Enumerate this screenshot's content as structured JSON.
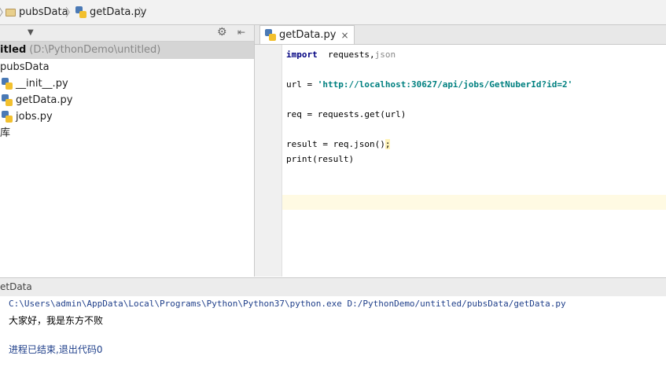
{
  "breadcrumb": {
    "items": [
      {
        "label": "pubsData",
        "icon": "folder-icon"
      },
      {
        "label": "getData.py",
        "icon": "python-file-icon"
      }
    ]
  },
  "project": {
    "root_name": "itled",
    "root_path": "(D:\\PythonDemo\\untitled)",
    "folder": "pubsData",
    "files": [
      "__init__.py",
      "getData.py",
      "jobs.py"
    ],
    "extra": "库"
  },
  "editor": {
    "tab_label": "getData.py",
    "tab_close": "×",
    "lines": [
      {
        "kw": "import",
        "rest": "  requests,",
        "tail": "json"
      },
      {
        "text": "url = ",
        "str": "'http://localhost:30627/api/jobs/GetNuberId?id=2'"
      },
      {
        "text": "req = requests.get(url)"
      },
      {
        "text": "result = req.json()",
        "caret": ";"
      },
      {
        "text": "print(result)"
      }
    ]
  },
  "run": {
    "title": "etData",
    "command": "C:\\Users\\admin\\AppData\\Local\\Programs\\Python\\Python37\\python.exe D:/PythonDemo/untitled/pubsData/getData.py",
    "output": "大家好，我是东方不败",
    "exit": "进程已结束,退出代码0"
  }
}
